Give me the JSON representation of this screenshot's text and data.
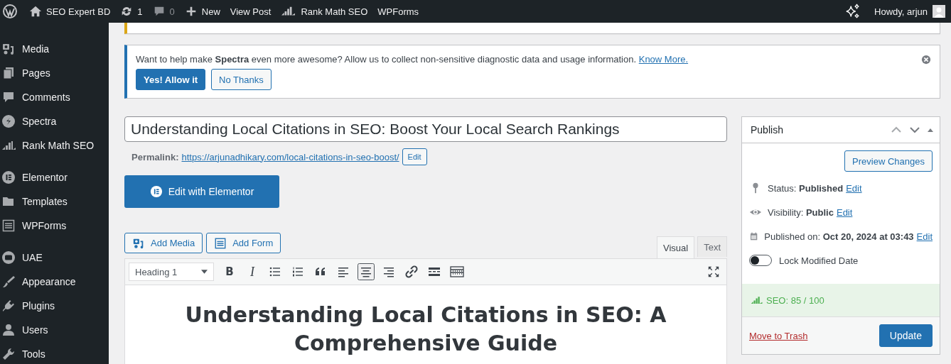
{
  "admin_bar": {
    "site": "SEO Expert BD",
    "updates": "1",
    "comments": "0",
    "new": "New",
    "view_post": "View Post",
    "rank_math": "Rank Math SEO",
    "wpforms": "WPForms",
    "greeting": "Howdy, arjun"
  },
  "sidebar": {
    "groups": [
      {
        "items": [
          {
            "label": "Media",
            "kind": "media"
          },
          {
            "label": "Pages",
            "kind": "pages"
          },
          {
            "label": "Comments",
            "kind": "comments"
          },
          {
            "label": "Spectra",
            "kind": "spectra"
          },
          {
            "label": "Rank Math SEO",
            "kind": "chart"
          }
        ]
      },
      {
        "items": [
          {
            "label": "Elementor",
            "kind": "elementor"
          },
          {
            "label": "Templates",
            "kind": "folder"
          },
          {
            "label": "WPForms",
            "kind": "form"
          }
        ]
      },
      {
        "items": [
          {
            "label": "UAE",
            "kind": "uae"
          },
          {
            "label": "Appearance",
            "kind": "brush"
          },
          {
            "label": "Plugins",
            "kind": "plug"
          },
          {
            "label": "Users",
            "kind": "user"
          },
          {
            "label": "Tools",
            "kind": "wrench"
          }
        ]
      }
    ]
  },
  "notice": {
    "text": "Want to help make **Spectra** even more awesome? Allow us to collect non-sensitive diagnostic data and usage information.",
    "link": "Know More.",
    "allow": "Yes! Allow it",
    "decline": "No Thanks"
  },
  "post": {
    "title": "Understanding Local Citations in SEO: Boost Your Local Search Rankings",
    "permalink_label": "Permalink:",
    "permalink": "https://arjunadhikary.com/local-citations-in-seo-boost/",
    "permalink_edit": "Edit",
    "elementor_button": "Edit with Elementor"
  },
  "editor": {
    "add_media": "Add Media",
    "add_form": "Add Form",
    "tabs": [
      {
        "label": "Visual",
        "selected": true
      },
      {
        "label": "Text",
        "selected": false
      }
    ],
    "format": "Heading 1",
    "toolbar": [
      {
        "kind": "bold",
        "text": "B",
        "pressed": false
      },
      {
        "kind": "italic",
        "text": "I",
        "pressed": false
      },
      {
        "kind": "bullets",
        "pressed": false
      },
      {
        "kind": "numbers",
        "pressed": false
      },
      {
        "kind": "quote",
        "pressed": false
      },
      {
        "kind": "align-left",
        "pressed": false
      },
      {
        "kind": "align-center",
        "pressed": true
      },
      {
        "kind": "align-right",
        "pressed": false
      },
      {
        "kind": "link",
        "pressed": false
      },
      {
        "kind": "more",
        "pressed": false
      },
      {
        "kind": "kitchen",
        "pressed": false
      }
    ],
    "content_heading": "Understanding Local Citations in SEO: A Comprehensive Guide"
  },
  "publish": {
    "title": "Publish",
    "preview": "Preview Changes",
    "rows": [
      {
        "kind": "status",
        "text": "Status: **Published**",
        "link": "Edit"
      },
      {
        "kind": "visibility",
        "text": "Visibility: **Public**",
        "link": "Edit"
      },
      {
        "kind": "date",
        "text": "Published on: **Oct 20, 2024 at 03:43**",
        "link": "Edit"
      }
    ],
    "lock": {
      "label": "Lock Modified Date",
      "on": false
    },
    "seo": "SEO: 85 / 100",
    "trash": "Move to Trash",
    "update": "Update"
  }
}
